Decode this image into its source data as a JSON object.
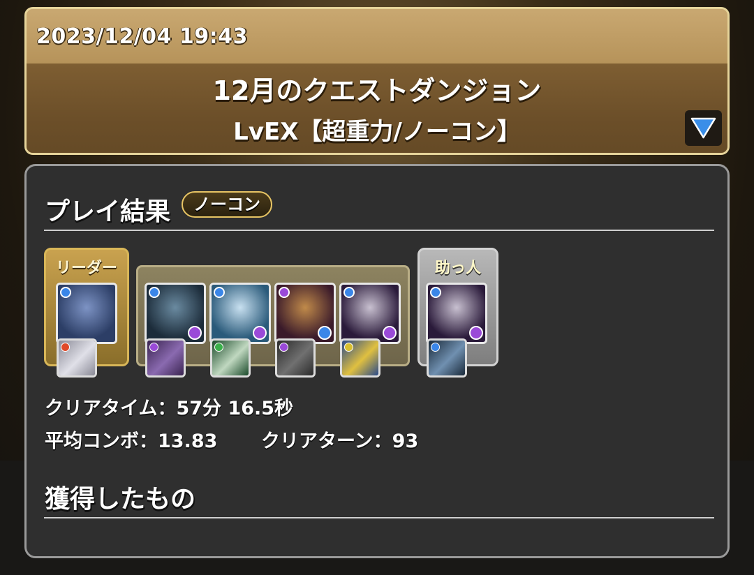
{
  "header": {
    "datetime": "2023/12/04 19:43",
    "dungeon_name": "12月のクエストダンジョン",
    "floor_name": "LvEX【超重力/ノーコン】"
  },
  "result": {
    "title": "プレイ結果",
    "badge": "ノーコン",
    "leader_label": "リーダー",
    "helper_label": "助っ人",
    "clear_time_label": "クリアタイム：",
    "clear_time_value": "57分 16.5秒",
    "avg_combo_label": "平均コンボ：",
    "avg_combo_value": "13.83",
    "clear_turns_label": "クリアターン：",
    "clear_turns_value": "93",
    "rewards_title": "獲得したもの"
  },
  "team": {
    "leader": {
      "name": "leader-monster",
      "art": [
        "#2c3e66",
        "#7d93c4"
      ],
      "main_attr": "#3a86e8",
      "sub_attr": null,
      "assist": {
        "art": [
          "#8a8a96",
          "#e0e0e8"
        ],
        "attr": "#e04a2a"
      }
    },
    "subs": [
      {
        "art": [
          "#1c2c3a",
          "#6a8aa0"
        ],
        "main_attr": "#3a86e8",
        "sub_attr": "#9a4ad8",
        "assist": {
          "art": [
            "#3a2450",
            "#8a6ab0"
          ],
          "attr": "#9a4ad8"
        }
      },
      {
        "art": [
          "#2a5a7a",
          "#c8e0f0"
        ],
        "main_attr": "#3a86e8",
        "sub_attr": "#9a4ad8",
        "assist": {
          "art": [
            "#1a4a2a",
            "#c0d8c0"
          ],
          "attr": "#3ab04a"
        }
      },
      {
        "art": [
          "#3a1a2a",
          "#c08a4a"
        ],
        "main_attr": "#9a4ad8",
        "sub_attr": "#3a86e8",
        "assist": {
          "art": [
            "#2a2a2a",
            "#707070"
          ],
          "attr": "#9a4ad8"
        }
      },
      {
        "art": [
          "#2a1a3a",
          "#c8c0d0"
        ],
        "main_attr": "#3a86e8",
        "sub_attr": "#9a4ad8",
        "assist": {
          "art": [
            "#2a4a8a",
            "#e0c040"
          ],
          "attr": "#d8c030"
        }
      }
    ],
    "helper": {
      "art": [
        "#2a1a3a",
        "#c8c0d0"
      ],
      "main_attr": "#3a86e8",
      "sub_attr": "#9a4ad8",
      "assist": {
        "art": [
          "#1a2a3a",
          "#7090b0"
        ],
        "attr": "#3a86e8"
      }
    }
  },
  "colors": {
    "header_border": "#e6d49a",
    "panel_bg": "#2f2f2f",
    "badge_border": "#e8c564",
    "expand_arrow": "#3a8ee8"
  },
  "icons": {
    "expand": "triangle-down-icon"
  }
}
